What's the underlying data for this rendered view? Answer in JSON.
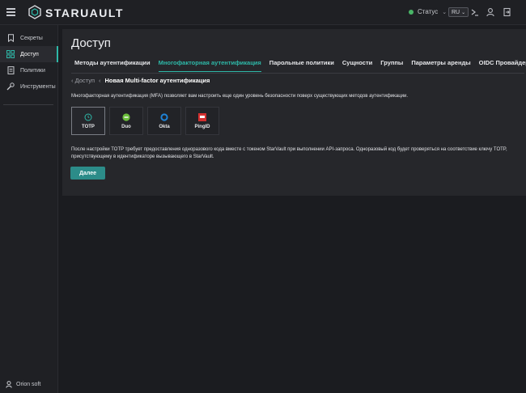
{
  "app": {
    "brand": "STARUAULT"
  },
  "topbar": {
    "status_label": "Статус",
    "status_color": "#49b567",
    "language": "RU",
    "icons": [
      "terminal-icon",
      "user-icon",
      "logout-icon"
    ]
  },
  "sidebar": {
    "items": [
      {
        "label": "Секреты",
        "icon": "bookmark-icon",
        "active": false
      },
      {
        "label": "Доступ",
        "icon": "grid-icon",
        "active": true
      },
      {
        "label": "Политики",
        "icon": "document-icon",
        "active": false
      },
      {
        "label": "Инструменты",
        "icon": "tools-icon",
        "active": false
      }
    ],
    "footer_user": "Orion soft"
  },
  "main": {
    "title": "Доступ",
    "tabs": [
      {
        "label": "Методы аутентификации",
        "active": false
      },
      {
        "label": "Многофакторная аутентификация",
        "active": true
      },
      {
        "label": "Парольные политики",
        "active": false
      },
      {
        "label": "Сущности",
        "active": false
      },
      {
        "label": "Группы",
        "active": false
      },
      {
        "label": "Параметры аренды",
        "active": false
      },
      {
        "label": "OIDC Провайдер",
        "active": false
      }
    ],
    "breadcrumb": {
      "parent": "Доступ",
      "current": "Новая Multi-factor аутентификация"
    },
    "description": "Многофакторная аутентификация (MFA) позволяет вам настроить еще один уровень безопасности поверх существующих методов аутентификации.",
    "methods": [
      {
        "label": "TOTP",
        "icon": "clock-icon",
        "selected": true
      },
      {
        "label": "Duo",
        "icon": "duo-icon",
        "selected": false
      },
      {
        "label": "Okta",
        "icon": "okta-icon",
        "selected": false
      },
      {
        "label": "PingID",
        "icon": "pingid-icon",
        "selected": false
      }
    ],
    "help_text": "После настройки TOTP требует предоставления одноразового кода вместе с токеном StarVault при выполнении API-запроса. Одноразовый код будет проверяться на соответствие ключу TOTP, присутствующему в идентификаторе вызывающего в StarVault.",
    "next_button": "Далее"
  },
  "colors": {
    "accent": "#2eb8a8",
    "button": "#2c8c89",
    "background": "#1b1c20",
    "panel": "#26272b"
  }
}
